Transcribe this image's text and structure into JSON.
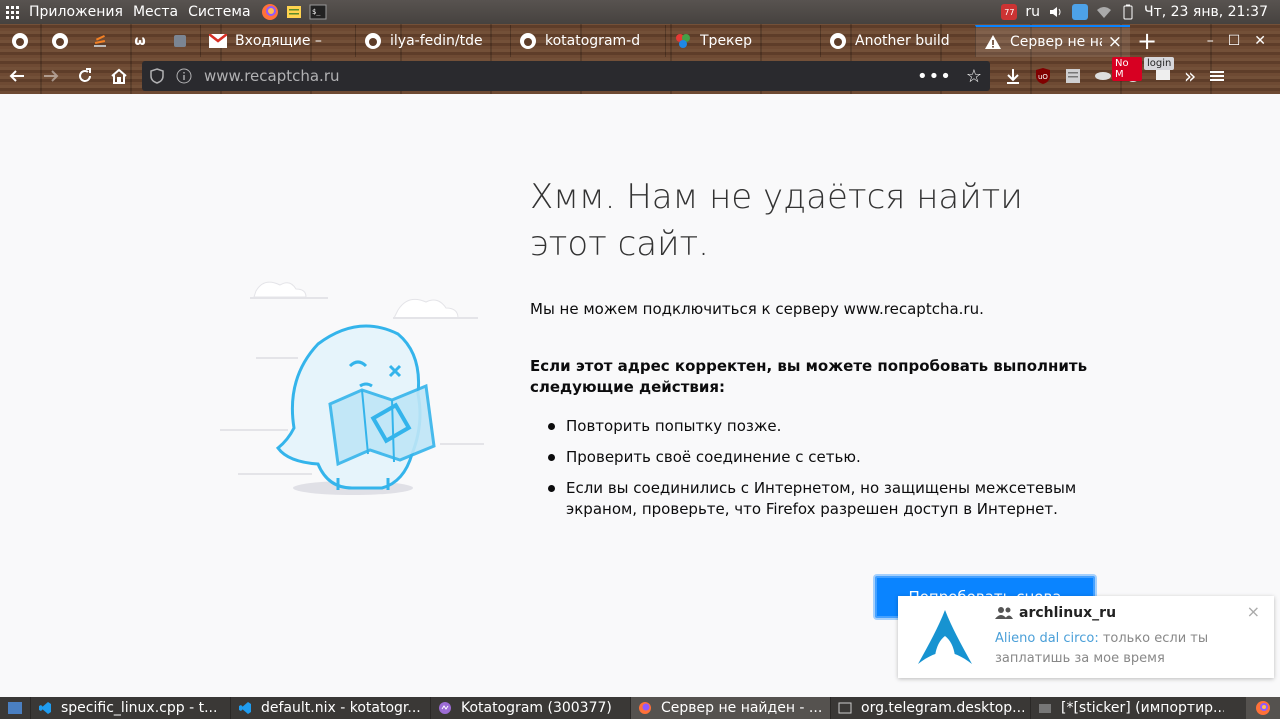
{
  "system_panel": {
    "menu": [
      "Приложения",
      "Места",
      "Система"
    ],
    "keyboard_layout": "ru",
    "datetime": "Чт, 23 янв, 21:37",
    "notification_count": "77"
  },
  "tabs": {
    "pinned": [
      {
        "icon": "github-icon"
      },
      {
        "icon": "github-icon"
      },
      {
        "icon": "stackoverflow-icon"
      },
      {
        "icon": "omega-icon",
        "glyph": "ω"
      },
      {
        "icon": "app-icon"
      }
    ],
    "items": [
      {
        "title": "Входящие –",
        "icon": "gmail-icon"
      },
      {
        "title": "ilya-fedin/tde",
        "icon": "github-icon"
      },
      {
        "title": "kotatogram-d",
        "icon": "github-icon"
      },
      {
        "title": "Трекер",
        "icon": "tracker-icon"
      },
      {
        "title": "Another build",
        "icon": "github-icon"
      },
      {
        "title": "Сервер не на",
        "icon": "warning-icon",
        "active": true
      }
    ],
    "new_tab": "+"
  },
  "navbar": {
    "url": "www.recaptcha.ru",
    "badge_nom": "No M",
    "badge_login": "login"
  },
  "error_page": {
    "title": "Хмм. Нам не удаётся найти этот сайт.",
    "description": "Мы не можем подключиться к серверу www.recaptcha.ru.",
    "hint": "Если этот адрес корректен, вы можете попробовать выполнить следующие действия:",
    "suggestions": [
      "Повторить попытку позже.",
      "Проверить своё соединение с сетью.",
      "Если вы соединились с Интернетом, но защищены межсетевым экраном, проверьте, что Firefox разрешен доступ в Интернет."
    ],
    "retry_label": "Попробовать снова"
  },
  "notification": {
    "group": "archlinux_ru",
    "sender": "Alieno dal circo:",
    "message": " только если ты заплатишь за мое время",
    "close": "×"
  },
  "taskbar": {
    "items": [
      {
        "title": "specific_linux.cpp - t...",
        "icon": "vscode-icon"
      },
      {
        "title": "default.nix - kotatogr...",
        "icon": "vscode-icon"
      },
      {
        "title": "Kotatogram (300377)",
        "icon": "kotatogram-icon"
      },
      {
        "title": "Сервер не найден - ...",
        "icon": "firefox-icon",
        "active": true
      },
      {
        "title": "org.telegram.desktop....",
        "icon": "window-icon"
      },
      {
        "title": "[*[sticker] (импортир...",
        "icon": "gimp-icon"
      }
    ]
  },
  "colors": {
    "accent": "#0a84ff",
    "illustration": "#34b4eb",
    "chrome_wood": "#6e4a33"
  }
}
